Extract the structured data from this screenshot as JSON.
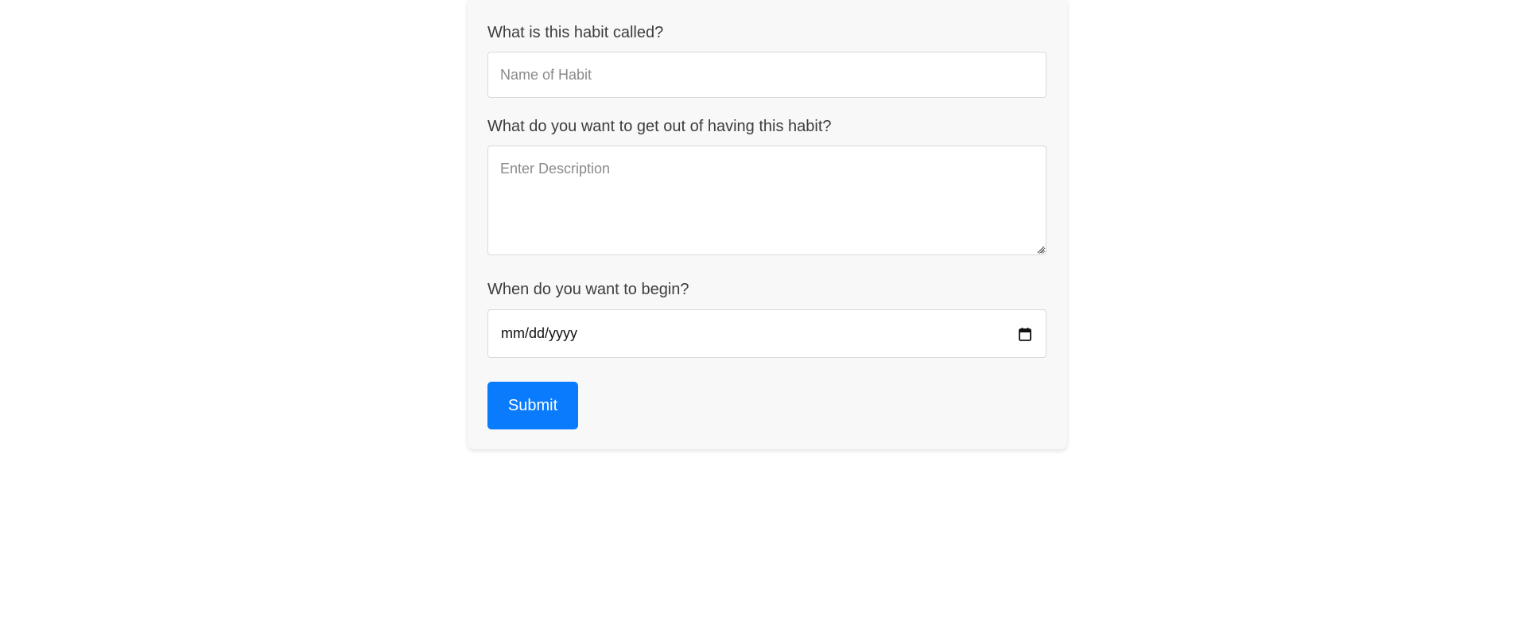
{
  "form": {
    "name_label": "What is this habit called?",
    "name_placeholder": "Name of Habit",
    "description_label": "What do you want to get out of having this habit?",
    "description_placeholder": "Enter Description",
    "date_label": "When do you want to begin?",
    "date_placeholder": "mm/dd/yyyy",
    "submit_label": "Submit"
  },
  "icons": {
    "calendar": "calendar-icon",
    "resize": "resize-grip-icon"
  },
  "colors": {
    "accent": "#0b7bfd",
    "card_background": "#f8f8f8"
  }
}
